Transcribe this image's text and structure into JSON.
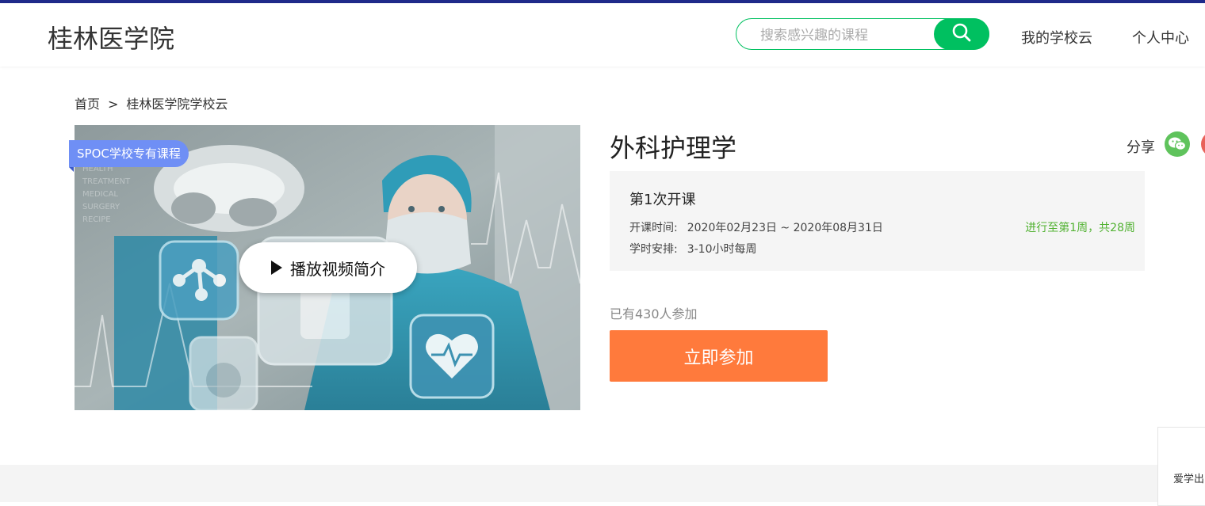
{
  "header": {
    "logo": "桂林医学院",
    "search_placeholder": "搜索感兴趣的课程",
    "nav": [
      "我的学校云",
      "个人中心"
    ],
    "accent_color": "#00c060"
  },
  "breadcrumb": [
    "首页",
    ">",
    "桂林医学院学校云"
  ],
  "media": {
    "badge": "SPOC学校专有课程",
    "play_label": "播放视频简介"
  },
  "course": {
    "title": "外科护理学",
    "share_label": "分享",
    "session": {
      "title": "第1次开课",
      "time_key": "开课时间:",
      "time_value": "2020年02月23日 ~ 2020年08月31日",
      "hours_key": "学时安排:",
      "hours_value": "3-10小时每周",
      "progress": "进行至第1周，共28周"
    },
    "enrolled": "已有430人参加",
    "join_label": "立即参加",
    "join_color": "#ff7a3c"
  },
  "side_widget": {
    "label": "爱学出"
  }
}
